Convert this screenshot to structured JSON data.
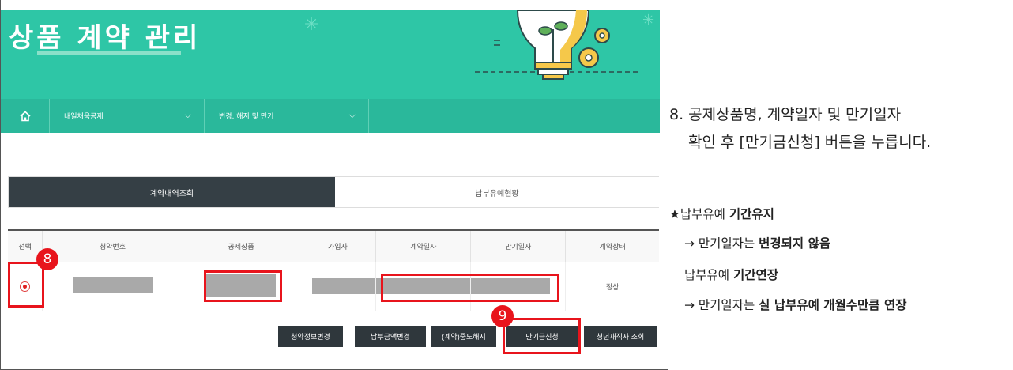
{
  "banner": {
    "title": "상품 계약 관리"
  },
  "nav": {
    "home_icon": "home-icon",
    "item1": "내일채움공제",
    "item2": "변경, 해지 및 만기"
  },
  "tabs": {
    "active": "계약내역조회",
    "other": "납부유예현황"
  },
  "table": {
    "headers": [
      "선택",
      "청약번호",
      "공제상품",
      "가입자",
      "계약일자",
      "만기일자",
      "계약상태"
    ],
    "row": {
      "status": "정상"
    }
  },
  "buttons": {
    "b1": "청약정보변경",
    "b2": "납부금액변경",
    "b3": "(계약)중도해지",
    "b4": "만기금신청",
    "b5": "청년재직자 조회"
  },
  "badges": {
    "b8": "8",
    "b9": "9"
  },
  "instructions": {
    "line1": "8. 공제상품명, 계약일자 및 만기일자",
    "line2": "확인 후 [만기금신청] 버튼을 누릅니다.",
    "l3_pre": "★납부유예 ",
    "l3_bold": "기간유지",
    "l4_pre": "→ 만기일자는 ",
    "l4_bold": "변경되지 않음",
    "l5_pre": "납부유예 ",
    "l5_bold": "기간연장",
    "l6_pre": "→ 만기일자는 ",
    "l6_bold": "실 납부유예 개월수만큼 연장"
  },
  "colors": {
    "banner": "#2ec6a6",
    "nav": "#2ab89b",
    "highlight": "#e8141c",
    "button": "#2f373c"
  }
}
